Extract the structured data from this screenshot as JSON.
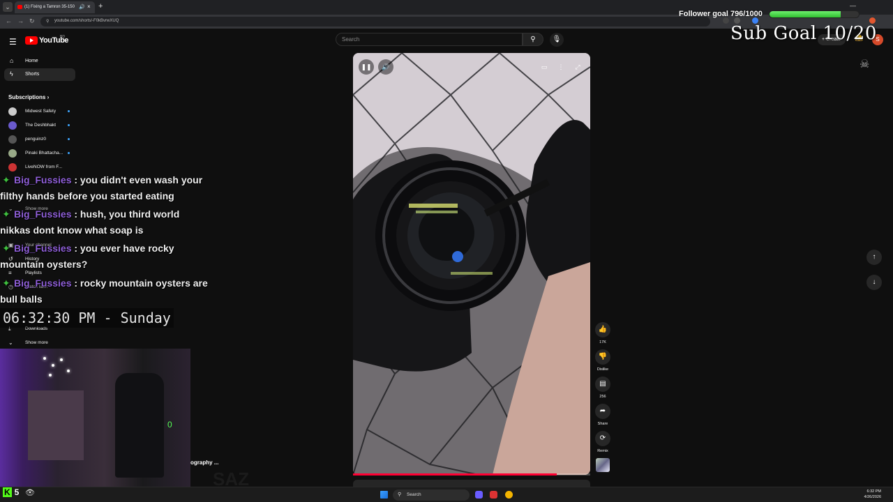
{
  "browser": {
    "tab_title": "(1) Fixing a Tamron 35-150",
    "url": "youtube.com/shorts/-F0kBvrwXUQ",
    "new_tab": "+",
    "close": "×"
  },
  "youtube": {
    "logo_text": "YouTube",
    "logo_sup": "BD",
    "search_placeholder": "Search",
    "create_label": "+ Create",
    "avatar_letter": "S"
  },
  "sidebar": {
    "home": "Home",
    "shorts": "Shorts",
    "subscriptions": "Subscriptions",
    "channels": [
      "Midwest Safety",
      "The Deshbhakt",
      "penguinz0",
      "Pinaki Bhattacha...",
      "LiveNOW from F..."
    ],
    "show_more_1": "Show more",
    "your_channel": "Your channel",
    "history": "History",
    "playlists": "Playlists",
    "watch_later": "Watch later",
    "downloads": "Downloads",
    "show_more_2": "Show more"
  },
  "actions": {
    "likes": "17K",
    "dislike": "Dislike",
    "comments": "256",
    "share": "Share",
    "remix": "Remix"
  },
  "player": {
    "progress": 0.86
  },
  "overlay": {
    "follower_goal": "Follower goal 796/1000",
    "follower_progress": 0.796,
    "sub_goal": "Sub Goal 10/20",
    "clock": "06:32:30 PM - Sunday",
    "video_title_fragment": "ography ...",
    "viewer_count": "5",
    "kick_label": "K"
  },
  "chat": [
    {
      "user": "Big_Fussies",
      "text": ": you didn't even wash your filthy hands before you started eating"
    },
    {
      "user": "Big_Fussies",
      "text": ": hush, you third world nikkas dont know what soap is"
    },
    {
      "user": "Big_Fussies",
      "text": ": you ever have rocky mountain oysters?"
    },
    {
      "user": "Big_Fussies",
      "text": ": rocky mountain oysters are bull balls"
    }
  ],
  "taskbar": {
    "search": "Search",
    "time": "6:32 PM",
    "date": "4/26/2026"
  },
  "colors": {
    "yt_red": "#ff0000",
    "progress_red": "#ff0033",
    "chat_user": "#8f5fd8",
    "follower_bar": "#3fce3f"
  }
}
